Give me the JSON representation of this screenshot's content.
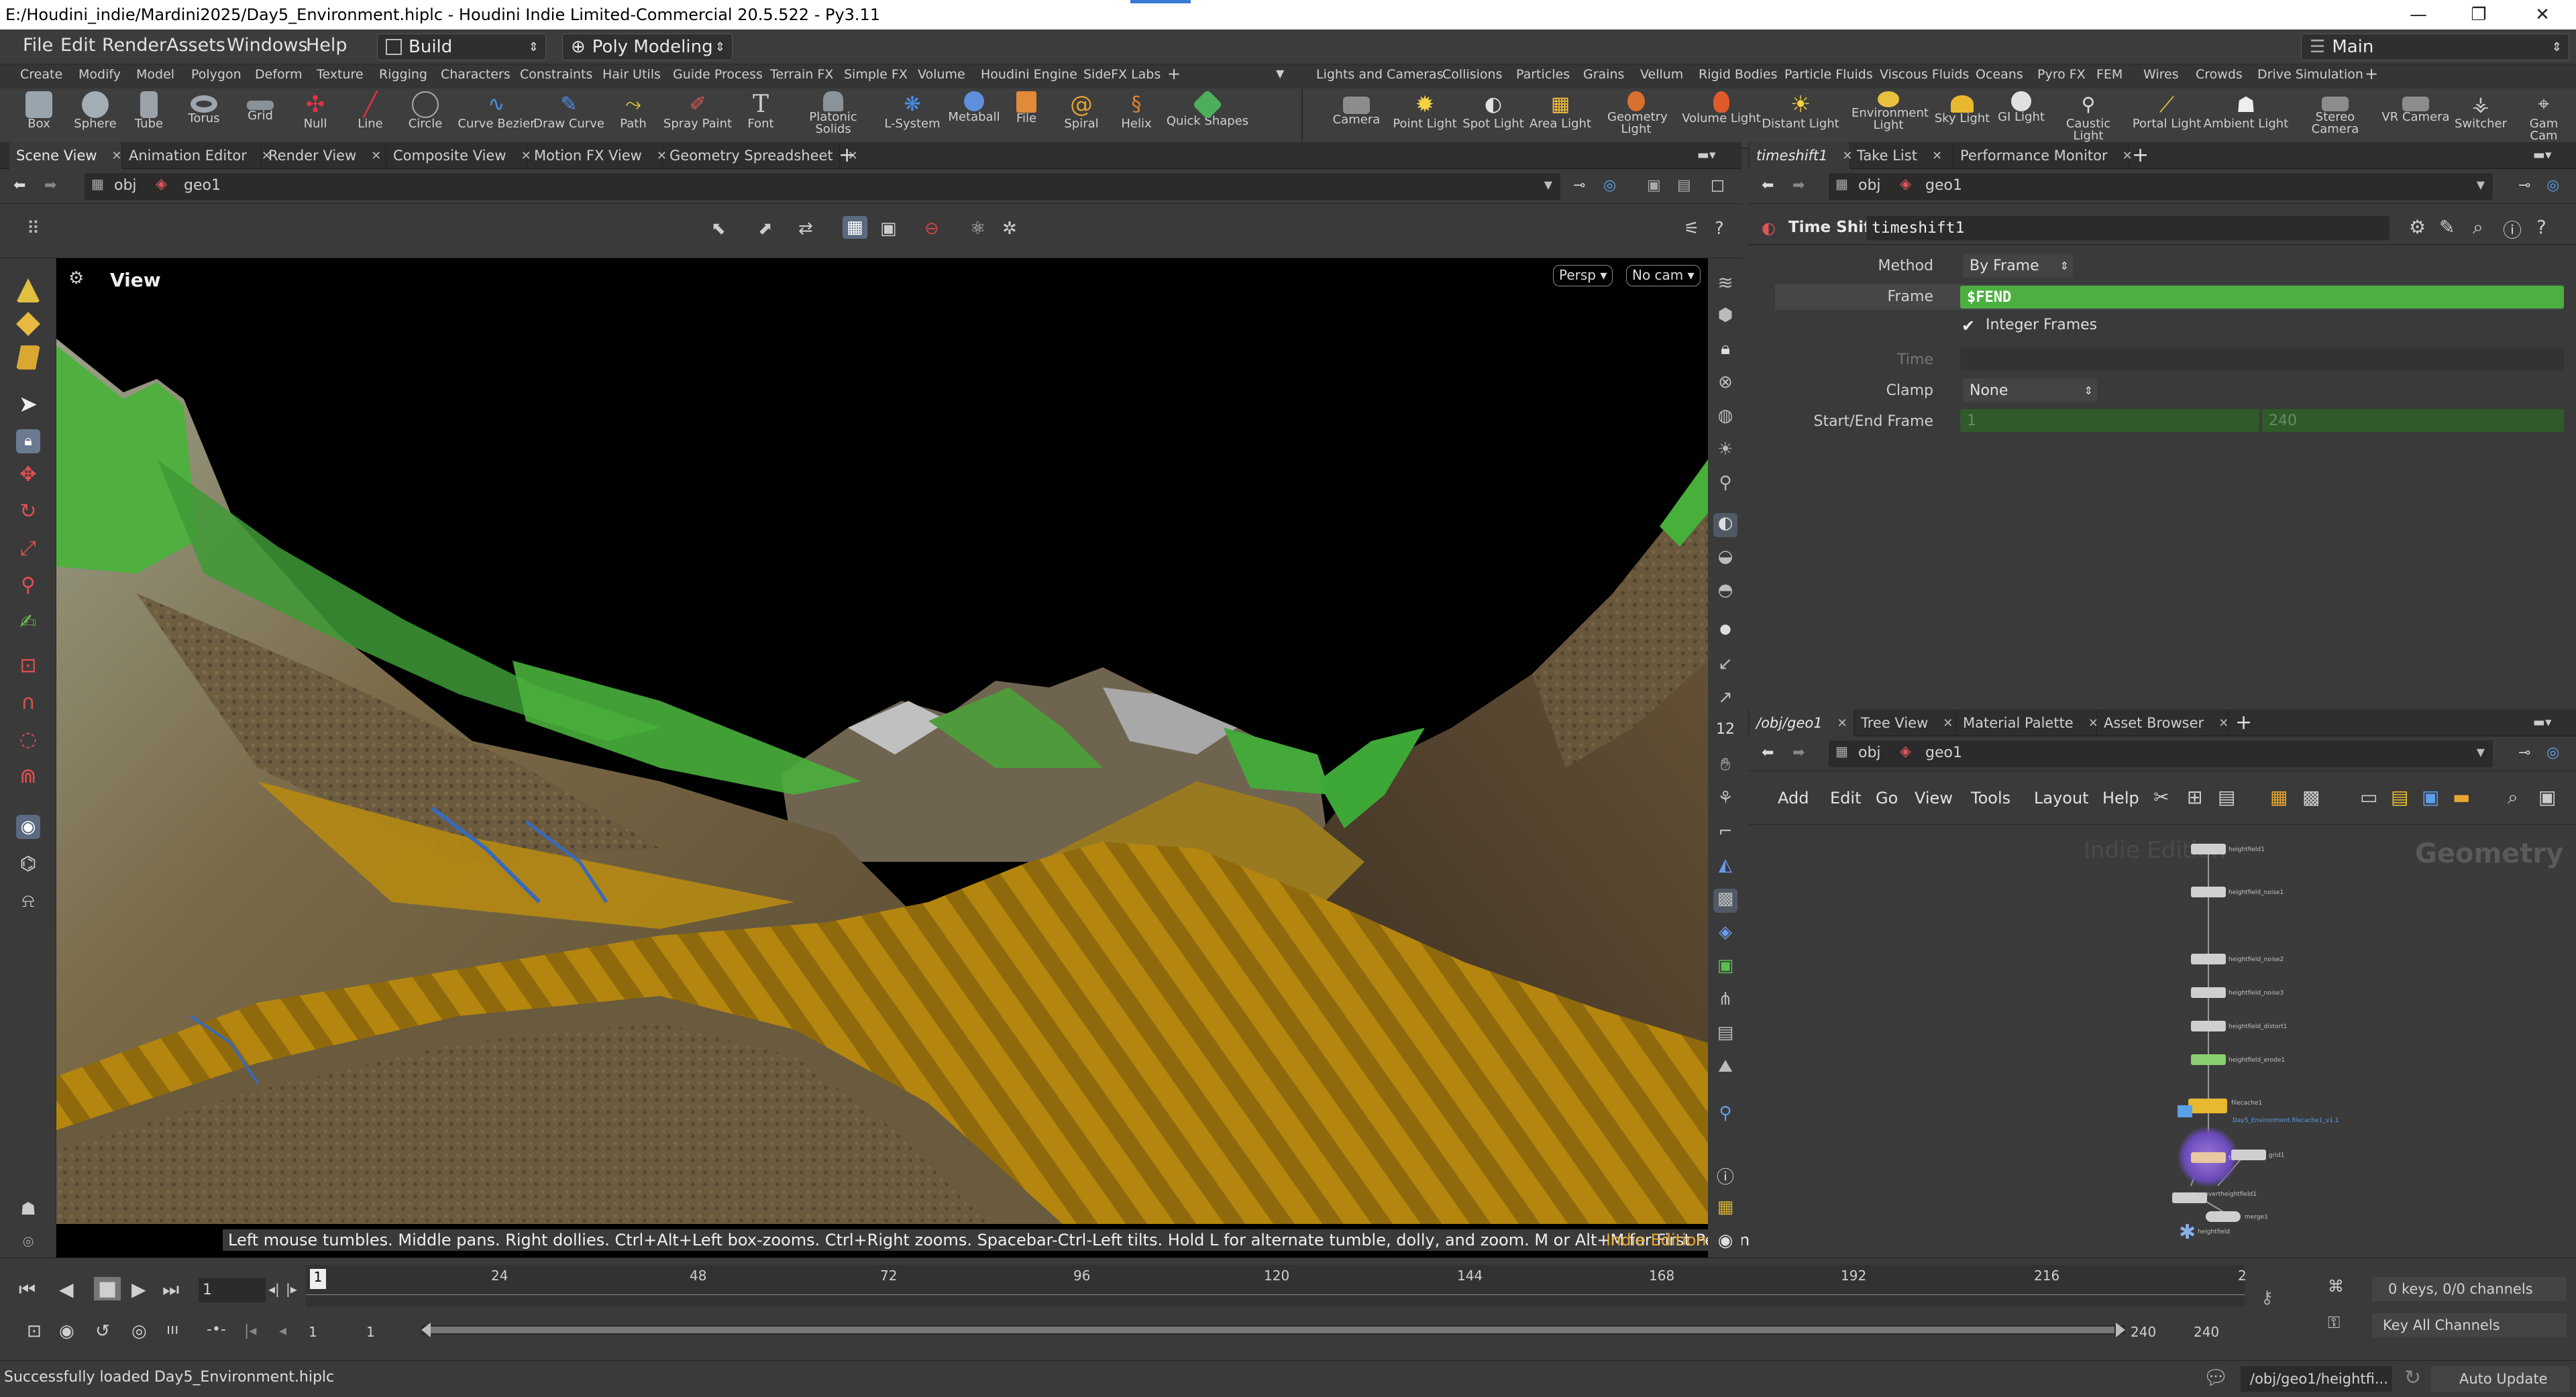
{
  "window": {
    "title": "E:/Houdini_indie/Mardini2025/Day5_Environment.hiplc - Houdini Indie Limited-Commercial 20.5.522 - Py3.11",
    "controls": [
      "—",
      "❐",
      "✕"
    ]
  },
  "menubar": {
    "items": [
      "File",
      "Edit",
      "Render",
      "Assets",
      "Windows",
      "Help"
    ],
    "desktop": "Build",
    "mode": "Poly Modeling",
    "workspace": "Main"
  },
  "shelf": {
    "left_tabs": [
      "Create",
      "Modify",
      "Model",
      "Polygon",
      "Deform",
      "Texture",
      "Rigging",
      "Characters",
      "Constraints",
      "Hair Utils",
      "Guide Process",
      "Terrain FX",
      "Simple FX",
      "Volume",
      "Houdini Engine",
      "SideFX Labs"
    ],
    "right_tabs": [
      "Lights and Cameras",
      "Collisions",
      "Particles",
      "Grains",
      "Vellum",
      "Rigid Bodies",
      "Particle Fluids",
      "Viscous Fluids",
      "Oceans",
      "Pyro FX",
      "FEM",
      "Wires",
      "Crowds",
      "Drive Simulation"
    ],
    "left_tools": [
      "Box",
      "Sphere",
      "Tube",
      "Torus",
      "Grid",
      "Null",
      "Line",
      "Circle",
      "Curve Bezier",
      "Draw Curve",
      "Path",
      "Spray Paint",
      "Font",
      "Platonic Solids",
      "L-System",
      "Metaball",
      "File",
      "Spiral",
      "Helix",
      "Quick Shapes"
    ],
    "right_tools": [
      "Camera",
      "Point Light",
      "Spot Light",
      "Area Light",
      "Geometry Light",
      "Volume Light",
      "Distant Light",
      "Environment Light",
      "Sky Light",
      "GI Light",
      "Caustic Light",
      "Portal Light",
      "Ambient Light",
      "Stereo Camera",
      "VR Camera",
      "Switcher",
      "Gam Cam"
    ]
  },
  "left_panel": {
    "tabs": [
      "Scene View",
      "Animation Editor",
      "Render View",
      "Composite View",
      "Motion FX View",
      "Geometry Spreadsheet"
    ],
    "path": [
      "obj",
      "geo1"
    ],
    "viewport": {
      "title": "View",
      "camera_persp": "Persp",
      "camera_nocam": "No cam",
      "hint": "Left mouse tumbles. Middle pans. Right dollies. Ctrl+Alt+Left box-zooms. Ctrl+Right zooms. Spacebar-Ctrl-Left tilts. Hold L for alternate tumble, dolly, and zoom. M or Alt+M for First Person Navigation.",
      "edition": "Indie Edition"
    }
  },
  "param_panel": {
    "tabs": [
      "timeshift1",
      "Take List",
      "Performance Monitor"
    ],
    "path": [
      "obj",
      "geo1"
    ],
    "node_type": "Time Shift",
    "node_name": "timeshift1",
    "params": {
      "method_label": "Method",
      "method_value": "By Frame",
      "frame_label": "Frame",
      "frame_value": "$FEND",
      "integer_frames": "Integer Frames",
      "time_label": "Time",
      "clamp_label": "Clamp",
      "clamp_value": "None",
      "startend_label": "Start/End Frame",
      "start_value": "1",
      "end_value": "240"
    }
  },
  "network_panel": {
    "tabs": [
      "/obj/geo1",
      "Tree View",
      "Material Palette",
      "Asset Browser"
    ],
    "path": [
      "obj",
      "geo1"
    ],
    "menu": [
      "Add",
      "Edit",
      "Go",
      "View",
      "Tools",
      "Layout",
      "Help"
    ],
    "watermark": "Indie Edition",
    "context": "Geometry",
    "nodes": [
      "heightfield1",
      "heightfield_noise1",
      "heightfield_noise2",
      "heightfield_noise3",
      "heightfield_distort1",
      "heightfield_erode1",
      "filecache1",
      "Day5_Environment.filecache1_v1.1",
      "timeshift1",
      "grid1",
      "convertheightfield1",
      "merge1",
      "heightfield"
    ]
  },
  "timeline": {
    "current_frame": "1",
    "ticks": [
      "24",
      "48",
      "72",
      "96",
      "120",
      "144",
      "168",
      "192",
      "216",
      "2"
    ],
    "marker": "1",
    "range_start": "1",
    "range_start2": "1",
    "range_end": "240",
    "range_end2": "240",
    "keys_info": "0 keys, 0/0 channels",
    "key_all": "Key All Channels"
  },
  "status": {
    "message": "Successfully loaded Day5_Environment.hiplc",
    "path": "/obj/geo1/heightfi...",
    "update_mode": "Auto Update"
  },
  "colors": {
    "frame_field": "#4caf3f",
    "accent_blue": "#3b7bd8",
    "viewport_bg": "#000000"
  }
}
